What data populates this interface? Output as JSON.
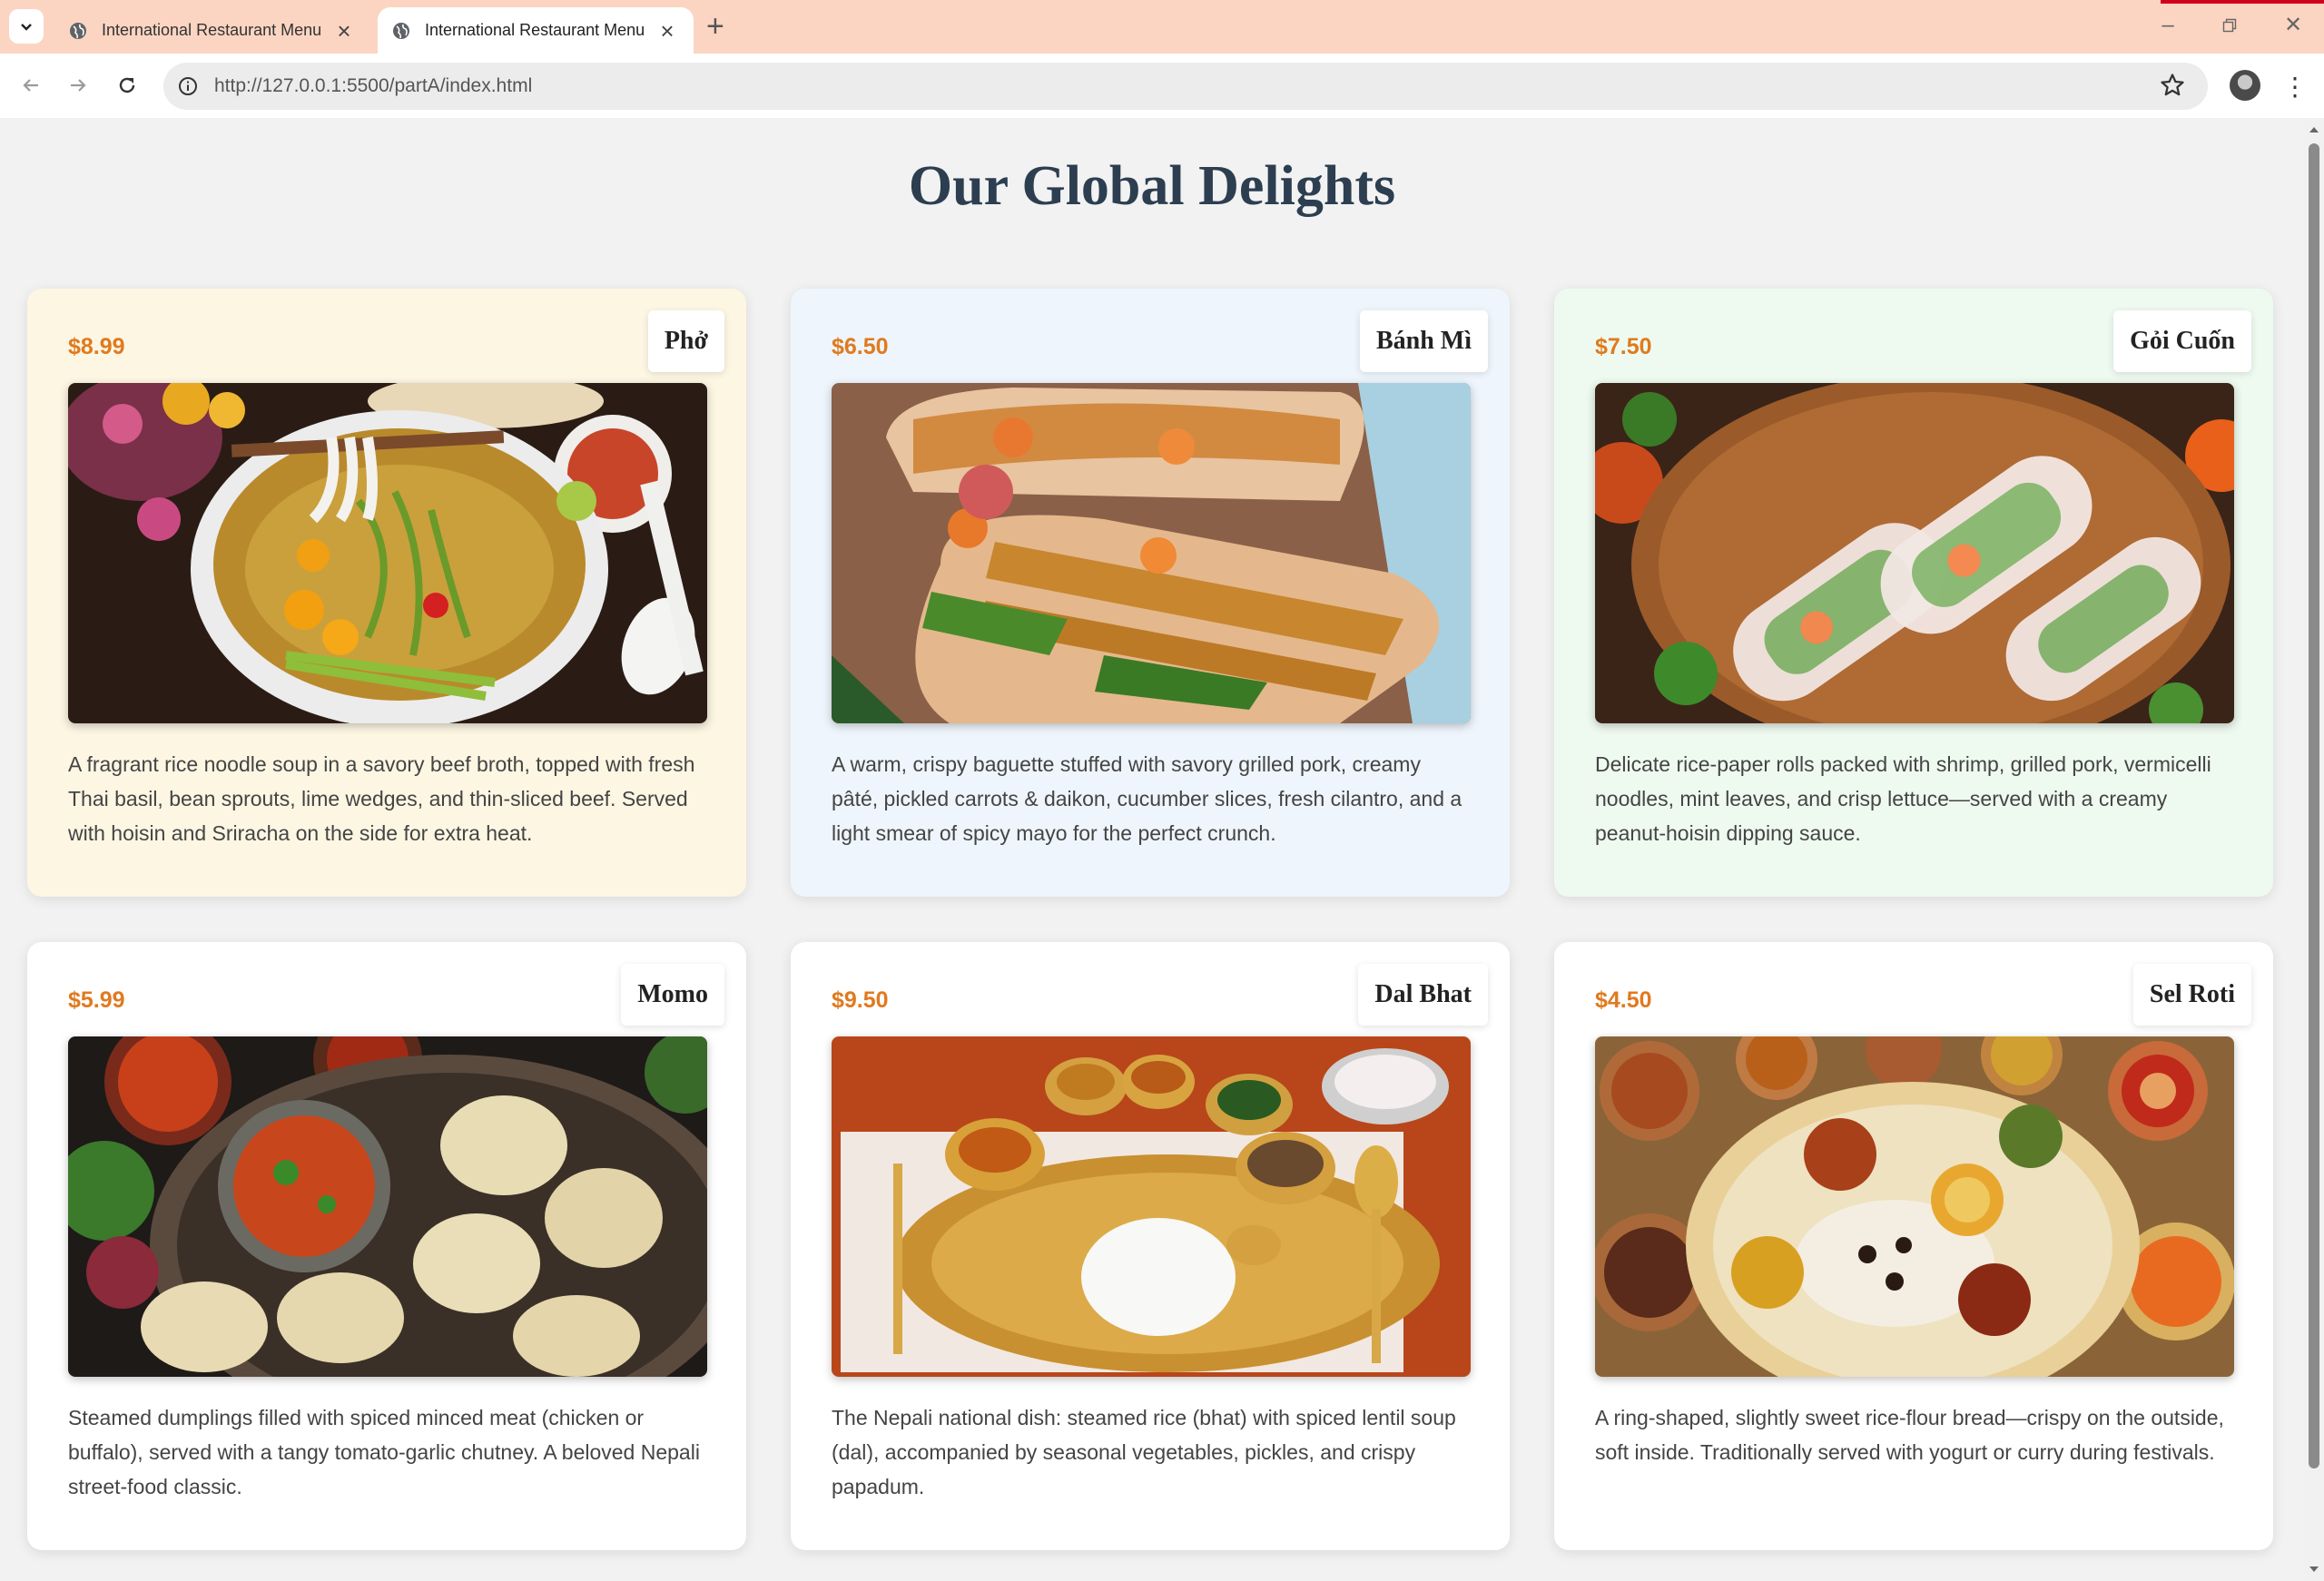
{
  "browser": {
    "tabs": [
      {
        "title": "International Restaurant Menu",
        "active": false
      },
      {
        "title": "International Restaurant Menu",
        "active": true
      }
    ],
    "url": "http://127.0.0.1:5500/partA/index.html"
  },
  "page": {
    "title": "Our Global Delights",
    "dishes": [
      {
        "name": "Phở",
        "price": "$8.99",
        "bg": "#fdf6e3",
        "description": "A fragrant rice noodle soup in a savory beef broth, topped with fresh Thai basil, bean sprouts, lime wedges, and thin-sliced beef. Served with hoisin and Sriracha on the side for extra heat."
      },
      {
        "name": "Bánh Mì",
        "price": "$6.50",
        "bg": "#eef5fc",
        "description": "A warm, crispy baguette stuffed with savory grilled pork, creamy pâté, pickled carrots & daikon, cucumber slices, fresh cilantro, and a light smear of spicy mayo for the perfect crunch."
      },
      {
        "name": "Gỏi Cuốn",
        "price": "$7.50",
        "bg": "#eefaf0",
        "description": "Delicate rice-paper rolls packed with shrimp, grilled pork, vermicelli noodles, mint leaves, and crisp lettuce—served with a creamy peanut-hoisin dipping sauce."
      },
      {
        "name": "Momo",
        "price": "$5.99",
        "bg": "#ffffff",
        "description": "Steamed dumplings filled with spiced minced meat (chicken or buffalo), served with a tangy tomato-garlic chutney. A beloved Nepali street-food classic."
      },
      {
        "name": "Dal Bhat",
        "price": "$9.50",
        "bg": "#ffffff",
        "description": "The Nepali national dish: steamed rice (bhat) with spiced lentil soup (dal), accompanied by seasonal vegetables, pickles, and crispy papadum."
      },
      {
        "name": "Sel Roti",
        "price": "$4.50",
        "bg": "#ffffff",
        "description": "A ring-shaped, slightly sweet rice-flour bread—crispy on the outside, soft inside. Traditionally served with yogurt or curry during festivals."
      }
    ]
  },
  "colors": {
    "title": "#2c3e50",
    "price": "#e07a1f",
    "tabbar": "#fbd5c2"
  },
  "icons": [
    "chevron-down-icon",
    "globe-icon",
    "close-icon",
    "plus-icon",
    "back-icon",
    "forward-icon",
    "reload-icon",
    "info-icon",
    "star-icon",
    "avatar",
    "kebab-menu-icon"
  ]
}
